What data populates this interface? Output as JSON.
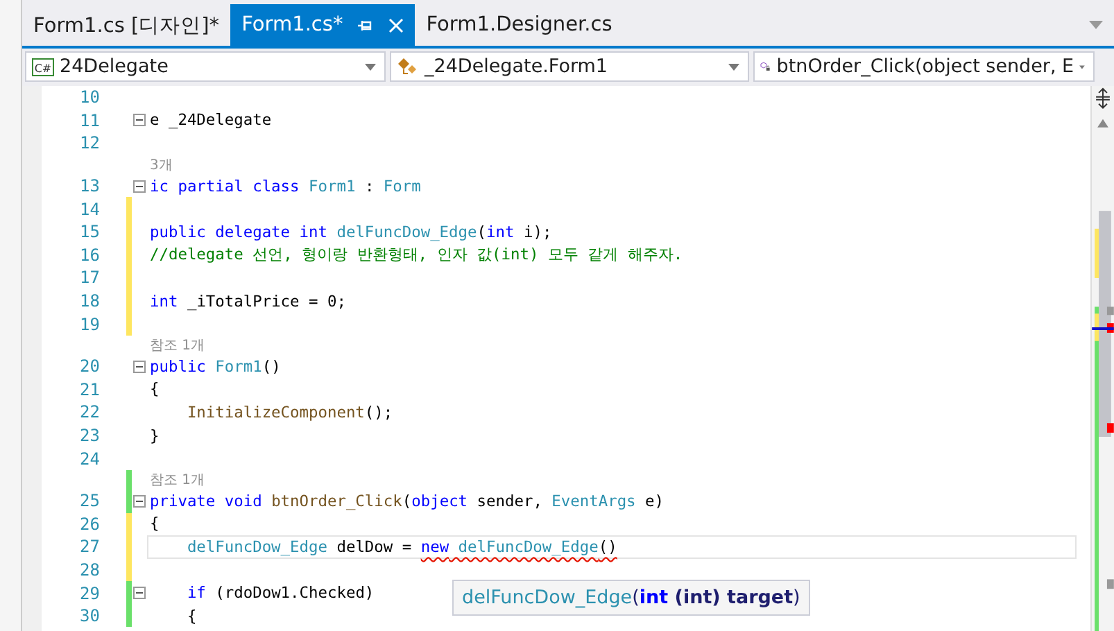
{
  "tabs": [
    {
      "label": "Form1.cs [디자인]*",
      "selected": false,
      "pinned": false,
      "closable": false
    },
    {
      "label": "Form1.cs*",
      "selected": true,
      "pinned": true,
      "closable": true
    },
    {
      "label": "Form1.Designer.cs",
      "selected": false,
      "pinned": false,
      "closable": false
    }
  ],
  "nav_bar": [
    {
      "kind": "project",
      "icon_text": "C#",
      "text": "24Delegate"
    },
    {
      "kind": "class",
      "text": "_24Delegate.Form1"
    },
    {
      "kind": "method",
      "text": "btnOrder_Click(object sender, E"
    }
  ],
  "code_lines": [
    {
      "kind": "code",
      "number": "10",
      "fold": false,
      "current": false
    },
    {
      "kind": "code",
      "number": "11",
      "fold": true,
      "current": false,
      "tokens": [
        {
          "kind": "plain",
          "s": "e _24Delegate"
        }
      ]
    },
    {
      "kind": "code",
      "number": "12",
      "fold": false,
      "current": false
    },
    {
      "kind": "lens",
      "text": "3개"
    },
    {
      "kind": "code",
      "number": "13",
      "fold": true,
      "current": false,
      "tokens": [
        {
          "kind": "keyword",
          "s": "ic partial class"
        },
        {
          "kind": "type",
          "s": " Form1"
        },
        {
          "kind": "plain",
          "s": " : "
        },
        {
          "kind": "type",
          "s": "Form"
        }
      ]
    },
    {
      "kind": "code",
      "number": "14",
      "color": "#fee660",
      "fold": false,
      "current": false
    },
    {
      "kind": "code",
      "number": "15",
      "color": "#fee660",
      "fold": false,
      "current": false,
      "tokens": [
        {
          "kind": "keyword",
          "s": "public delegate int"
        },
        {
          "kind": "type",
          "s": " delFuncDow_Edge"
        },
        {
          "kind": "plain",
          "s": "("
        },
        {
          "kind": "keyword",
          "s": "int"
        },
        {
          "kind": "plain",
          "s": " i);"
        }
      ]
    },
    {
      "kind": "code",
      "number": "16",
      "color": "#fee660",
      "fold": false,
      "current": false,
      "tokens": [
        {
          "kind": "comment",
          "s": "//delegate 선언, 형이랑 반환형태, 인자 값(int) 모두 같게 해주자."
        }
      ]
    },
    {
      "kind": "code",
      "number": "17",
      "color": "#fee660",
      "fold": false,
      "current": false
    },
    {
      "kind": "code",
      "number": "18",
      "color": "#fee660",
      "fold": false,
      "current": false,
      "tokens": [
        {
          "kind": "keyword",
          "s": "int"
        },
        {
          "kind": "plain",
          "s": " _iTotalPrice = 0;"
        }
      ]
    },
    {
      "kind": "code",
      "number": "19",
      "color": "#fee660",
      "fold": false,
      "current": false
    },
    {
      "kind": "lens",
      "text": "참조 1개"
    },
    {
      "kind": "code",
      "number": "20",
      "fold": true,
      "current": false,
      "tokens": [
        {
          "kind": "keyword",
          "s": "public"
        },
        {
          "kind": "type",
          "s": " Form1"
        },
        {
          "kind": "plain",
          "s": "()"
        }
      ]
    },
    {
      "kind": "code",
      "number": "21",
      "fold": false,
      "current": false,
      "tokens": [
        {
          "kind": "plain",
          "s": "{"
        }
      ]
    },
    {
      "kind": "code",
      "number": "22",
      "fold": false,
      "current": false,
      "tokens": [
        {
          "kind": "method",
          "s": "    InitializeComponent"
        },
        {
          "kind": "plain",
          "s": "();"
        }
      ]
    },
    {
      "kind": "code",
      "number": "23",
      "fold": false,
      "current": false,
      "tokens": [
        {
          "kind": "plain",
          "s": "}"
        }
      ]
    },
    {
      "kind": "code",
      "number": "24",
      "fold": false,
      "current": false
    },
    {
      "kind": "lens",
      "text": "참조 1개",
      "color": "#6ae06a"
    },
    {
      "kind": "code",
      "number": "25",
      "color": "#6ae06a",
      "fold": true,
      "current": false,
      "tokens": [
        {
          "kind": "keyword",
          "s": "private void"
        },
        {
          "kind": "method",
          "s": " btnOrder_Click"
        },
        {
          "kind": "plain",
          "s": "("
        },
        {
          "kind": "keyword",
          "s": "object"
        },
        {
          "kind": "plain",
          "s": " sender, "
        },
        {
          "kind": "type",
          "s": "EventArgs"
        },
        {
          "kind": "plain",
          "s": " e)"
        }
      ]
    },
    {
      "kind": "code",
      "number": "26",
      "color": "#fee660",
      "fold": false,
      "current": false,
      "tokens": [
        {
          "kind": "plain",
          "s": "{"
        }
      ]
    },
    {
      "kind": "code",
      "number": "27",
      "color": "#fee660",
      "fold": false,
      "current": true,
      "tokens": [
        {
          "kind": "type",
          "s": "    delFuncDow_Edge"
        },
        {
          "kind": "plain",
          "s": " delDow = "
        },
        {
          "kind": "keyword",
          "s": "new",
          "error": true
        },
        {
          "kind": "type",
          "s": " delFuncDow_Edge",
          "error": true
        },
        {
          "kind": "plain",
          "s": "()",
          "error": true
        }
      ]
    },
    {
      "kind": "code",
      "number": "28",
      "color": "#fee660",
      "fold": false,
      "current": false
    },
    {
      "kind": "code",
      "number": "29",
      "color": "#6ae06a",
      "fold": true,
      "current": false,
      "tokens": [
        {
          "kind": "keyword",
          "s": "    if"
        },
        {
          "kind": "plain",
          "s": " (rdoDow1.Checked)"
        }
      ]
    },
    {
      "kind": "code",
      "number": "30",
      "color": "#6ae06a",
      "fold": false,
      "current": false,
      "tokens": [
        {
          "kind": "plain",
          "s": "    {"
        }
      ]
    }
  ],
  "tooltip": [
    {
      "kind": "type",
      "s": "delFuncDow_Edge"
    },
    {
      "kind": "plain",
      "s": "("
    },
    {
      "kind": "keyword",
      "s": "int"
    },
    {
      "kind": "bold",
      "s": " (int)"
    },
    {
      "kind": "param",
      "s": " target"
    },
    {
      "kind": "plain",
      "s": ")"
    }
  ]
}
